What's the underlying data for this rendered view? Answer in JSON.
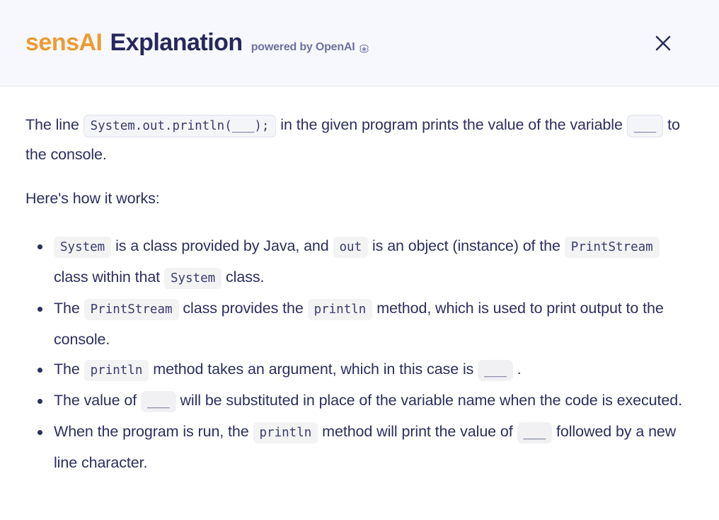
{
  "header": {
    "brand": "sensAI",
    "title": "Explanation",
    "powered_by": "powered by OpenAI",
    "openai_icon": "openai-logo-icon",
    "close_icon": "close-icon",
    "background_color": "#f7f8fd",
    "brand_color": "#ed9b33",
    "title_color": "#26275c"
  },
  "body": {
    "intro": {
      "part1": "The line ",
      "code": "System.out.println(___);",
      "part2": " in the given program prints the value of the variable ",
      "blank": "___",
      "part3": " to the console."
    },
    "subheading": "Here's how it works:",
    "bullets": [
      {
        "s1": "",
        "c1": "System",
        "s2": " is a class provided by Java, and ",
        "c2": "out",
        "s3": " is an object (instance) of the ",
        "c3": "PrintStream",
        "s4": " class within that ",
        "c4": "System",
        "s5": " class."
      },
      {
        "s1": "The ",
        "c1": "PrintStream",
        "s2": " class provides the ",
        "c2": "println",
        "s3": " method, which is used to print output to the console."
      },
      {
        "s1": "The ",
        "c1": "println",
        "s2": " method takes an argument, which in this case is ",
        "c2": "___",
        "s3": " ."
      },
      {
        "s1": "The value of ",
        "c1": "___",
        "s2": " will be substituted in place of the variable name when the code is executed."
      },
      {
        "s1": "When the program is run, the ",
        "c1": "println",
        "s2": " method will print the value of ",
        "c2": "___",
        "s3": " followed by a new line character."
      }
    ]
  }
}
